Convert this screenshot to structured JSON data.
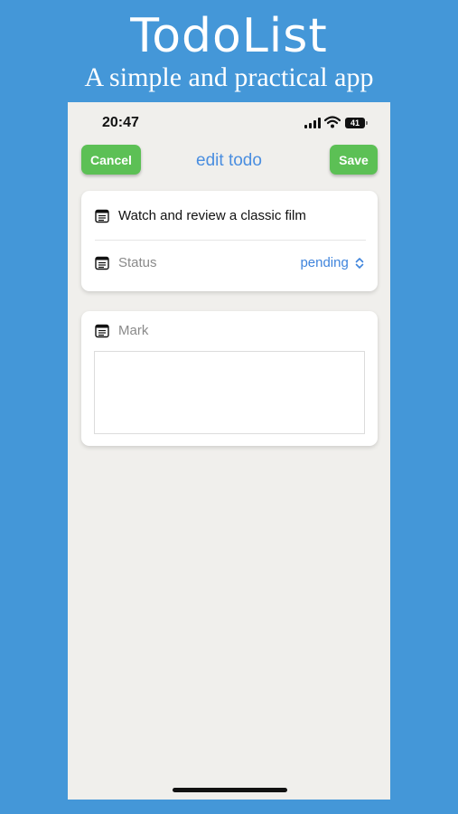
{
  "promo": {
    "title": "TodoList",
    "subtitle": "A simple and practical app"
  },
  "status_bar": {
    "time": "20:47",
    "battery": "41"
  },
  "nav": {
    "cancel_label": "Cancel",
    "title": "edit todo",
    "save_label": "Save"
  },
  "form": {
    "todo_title": "Watch and review a classic film",
    "status_label": "Status",
    "status_value": "pending",
    "mark_label": "Mark",
    "mark_value": ""
  },
  "colors": {
    "background": "#4497d8",
    "accent_blue": "#4a8ee0",
    "button_green": "#5cc055",
    "screen_bg": "#f0efec"
  },
  "icons": [
    "cellular-signal-icon",
    "wifi-icon",
    "battery-icon",
    "note-icon",
    "chevron-up-down-icon"
  ]
}
